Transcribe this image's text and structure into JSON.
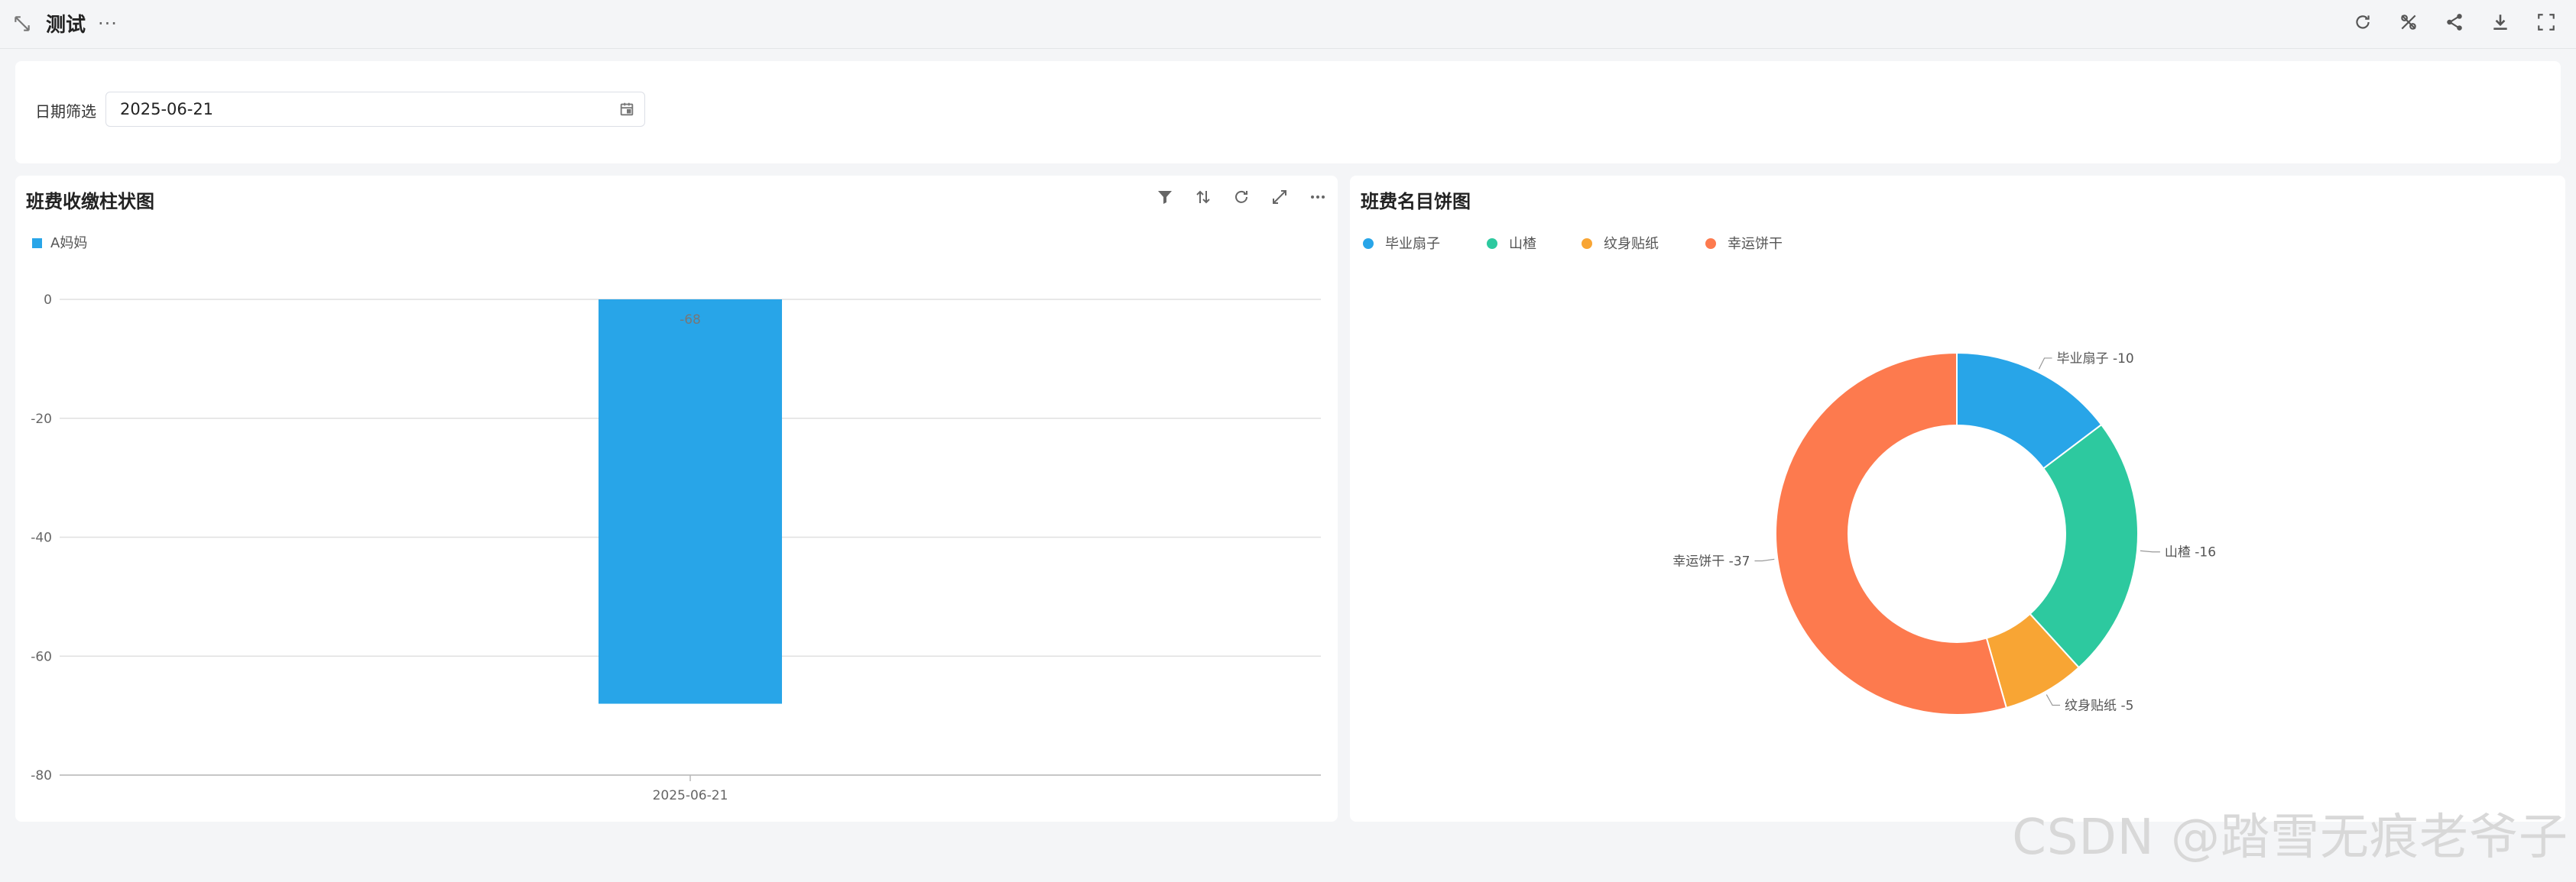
{
  "header": {
    "title": "测试",
    "more": "···"
  },
  "filter": {
    "label": "日期筛选",
    "value": "2025-06-21"
  },
  "bar_card": {
    "title": "班费收缴柱状图"
  },
  "pie_card": {
    "title": "班费名目饼图"
  },
  "colors": {
    "bar": "#28a5e8",
    "slices": [
      "#28a5e8",
      "#2dc99f",
      "#f8a534",
      "#fd7a4e"
    ]
  },
  "chart_data": [
    {
      "type": "bar",
      "title": "班费收缴柱状图",
      "categories": [
        "2025-06-21"
      ],
      "series": [
        {
          "name": "A妈妈",
          "values": [
            -68
          ]
        }
      ],
      "ylim": [
        -80,
        0
      ],
      "yticks": [
        0,
        -20,
        -40,
        -60,
        -80
      ],
      "xlabel": "",
      "ylabel": "",
      "grid": true,
      "legend": "top-left"
    },
    {
      "type": "pie",
      "title": "班费名目饼图",
      "donut": true,
      "labels": [
        "毕业扇子",
        "山楂",
        "纹身贴纸",
        "幸运饼干"
      ],
      "values": [
        -10,
        -16,
        -5,
        -37
      ],
      "legend": "top-left"
    }
  ],
  "watermark": "CSDN @踏雪无痕老爷子"
}
